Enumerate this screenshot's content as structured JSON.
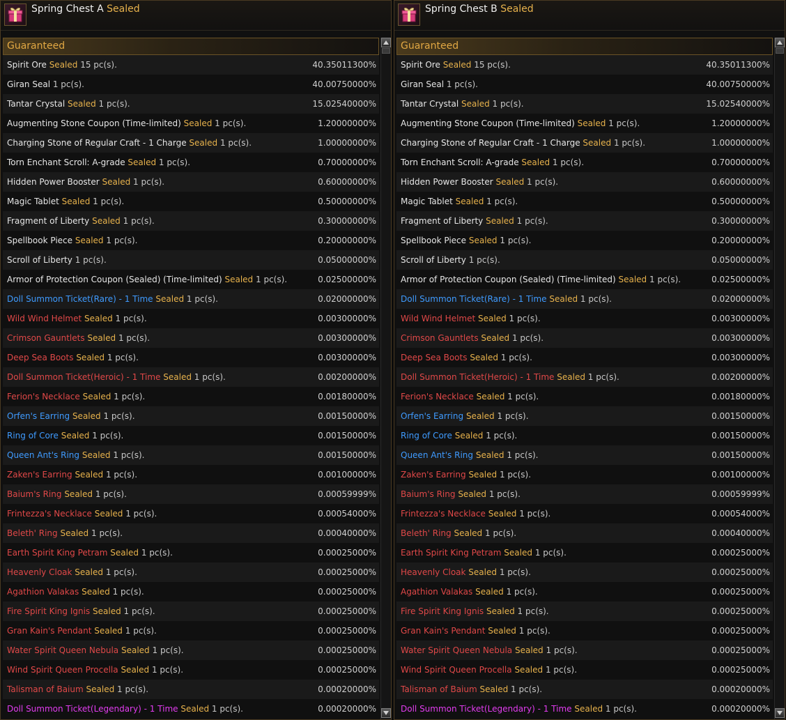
{
  "panels": [
    {
      "title": "Spring Chest A",
      "title_sealed": "Sealed",
      "section": "Guaranteed"
    },
    {
      "title": "Spring Chest B",
      "title_sealed": "Sealed",
      "section": "Guaranteed"
    }
  ],
  "colors": {
    "white": "#e6e6e6",
    "blue": "#3f9bff",
    "red": "#e04848",
    "pink": "#e23cf0",
    "sealed": "#e7b24c",
    "section": "#e2a843"
  },
  "items": [
    {
      "name": "Spirit Ore",
      "color": "white",
      "sealed": "Sealed",
      "qty": "15 pc(s).",
      "pct": "40.35011300%"
    },
    {
      "name": "Giran Seal",
      "color": "white",
      "sealed": "",
      "qty": "1 pc(s).",
      "pct": "40.00750000%"
    },
    {
      "name": "Tantar Crystal",
      "color": "white",
      "sealed": "Sealed",
      "qty": "1 pc(s).",
      "pct": "15.02540000%"
    },
    {
      "name": "Augmenting Stone Coupon (Time-limited)",
      "color": "white",
      "sealed": "Sealed",
      "qty": "1 pc(s).",
      "pct": "1.20000000%"
    },
    {
      "name": "Charging Stone of Regular Craft - 1 Charge",
      "color": "white",
      "sealed": "Sealed",
      "qty": "1 pc(s).",
      "pct": "1.00000000%"
    },
    {
      "name": "Torn Enchant Scroll: A-grade",
      "color": "white",
      "sealed": "Sealed",
      "qty": "1 pc(s).",
      "pct": "0.70000000%"
    },
    {
      "name": "Hidden Power Booster",
      "color": "white",
      "sealed": "Sealed",
      "qty": "1 pc(s).",
      "pct": "0.60000000%"
    },
    {
      "name": "Magic Tablet",
      "color": "white",
      "sealed": "Sealed",
      "qty": "1 pc(s).",
      "pct": "0.50000000%"
    },
    {
      "name": "Fragment of Liberty",
      "color": "white",
      "sealed": "Sealed",
      "qty": "1 pc(s).",
      "pct": "0.30000000%"
    },
    {
      "name": "Spellbook Piece",
      "color": "white",
      "sealed": "Sealed",
      "qty": "1 pc(s).",
      "pct": "0.20000000%"
    },
    {
      "name": "Scroll of Liberty",
      "color": "white",
      "sealed": "",
      "qty": "1 pc(s).",
      "pct": "0.05000000%"
    },
    {
      "name": "Armor of Protection Coupon (Sealed) (Time-limited)",
      "color": "white",
      "sealed": "Sealed",
      "qty": "1 pc(s).",
      "pct": "0.02500000%"
    },
    {
      "name": "Doll Summon Ticket(Rare) - 1 Time",
      "color": "blue",
      "sealed": "Sealed",
      "qty": "1 pc(s).",
      "pct": "0.02000000%"
    },
    {
      "name": "Wild Wind Helmet",
      "color": "red",
      "sealed": "Sealed",
      "qty": "1 pc(s).",
      "pct": "0.00300000%"
    },
    {
      "name": "Crimson Gauntlets",
      "color": "red",
      "sealed": "Sealed",
      "qty": "1 pc(s).",
      "pct": "0.00300000%"
    },
    {
      "name": "Deep Sea Boots",
      "color": "red",
      "sealed": "Sealed",
      "qty": "1 pc(s).",
      "pct": "0.00300000%"
    },
    {
      "name": "Doll Summon Ticket(Heroic) - 1 Time",
      "color": "red",
      "sealed": "Sealed",
      "qty": "1 pc(s).",
      "pct": "0.00200000%"
    },
    {
      "name": "Ferion's Necklace",
      "color": "red",
      "sealed": "Sealed",
      "qty": "1 pc(s).",
      "pct": "0.00180000%"
    },
    {
      "name": "Orfen's Earring",
      "color": "blue",
      "sealed": "Sealed",
      "qty": "1 pc(s).",
      "pct": "0.00150000%"
    },
    {
      "name": "Ring of Core",
      "color": "blue",
      "sealed": "Sealed",
      "qty": "1 pc(s).",
      "pct": "0.00150000%"
    },
    {
      "name": "Queen Ant's Ring",
      "color": "blue",
      "sealed": "Sealed",
      "qty": "1 pc(s).",
      "pct": "0.00150000%"
    },
    {
      "name": "Zaken's Earring",
      "color": "red",
      "sealed": "Sealed",
      "qty": "1 pc(s).",
      "pct": "0.00100000%"
    },
    {
      "name": "Baium's Ring",
      "color": "red",
      "sealed": "Sealed",
      "qty": "1 pc(s).",
      "pct": "0.00059999%"
    },
    {
      "name": "Frintezza's Necklace",
      "color": "red",
      "sealed": "Sealed",
      "qty": "1 pc(s).",
      "pct": "0.00054000%"
    },
    {
      "name": "Beleth' Ring",
      "color": "red",
      "sealed": "Sealed",
      "qty": "1 pc(s).",
      "pct": "0.00040000%"
    },
    {
      "name": "Earth Spirit King Petram",
      "color": "red",
      "sealed": "Sealed",
      "qty": "1 pc(s).",
      "pct": "0.00025000%"
    },
    {
      "name": "Heavenly Cloak",
      "color": "red",
      "sealed": "Sealed",
      "qty": "1 pc(s).",
      "pct": "0.00025000%"
    },
    {
      "name": "Agathion Valakas",
      "color": "red",
      "sealed": "Sealed",
      "qty": "1 pc(s).",
      "pct": "0.00025000%"
    },
    {
      "name": "Fire Spirit King Ignis",
      "color": "red",
      "sealed": "Sealed",
      "qty": "1 pc(s).",
      "pct": "0.00025000%"
    },
    {
      "name": "Gran Kain's Pendant",
      "color": "red",
      "sealed": "Sealed",
      "qty": "1 pc(s).",
      "pct": "0.00025000%"
    },
    {
      "name": "Water Spirit Queen Nebula",
      "color": "red",
      "sealed": "Sealed",
      "qty": "1 pc(s).",
      "pct": "0.00025000%"
    },
    {
      "name": "Wind Spirit Queen Procella",
      "color": "red",
      "sealed": "Sealed",
      "qty": "1 pc(s).",
      "pct": "0.00025000%"
    },
    {
      "name": "Talisman of Baium",
      "color": "red",
      "sealed": "Sealed",
      "qty": "1 pc(s).",
      "pct": "0.00020000%"
    },
    {
      "name": "Doll Summon Ticket(Legendary) - 1 Time",
      "color": "pink",
      "sealed": "Sealed",
      "qty": "1 pc(s).",
      "pct": "0.00020000%"
    }
  ]
}
